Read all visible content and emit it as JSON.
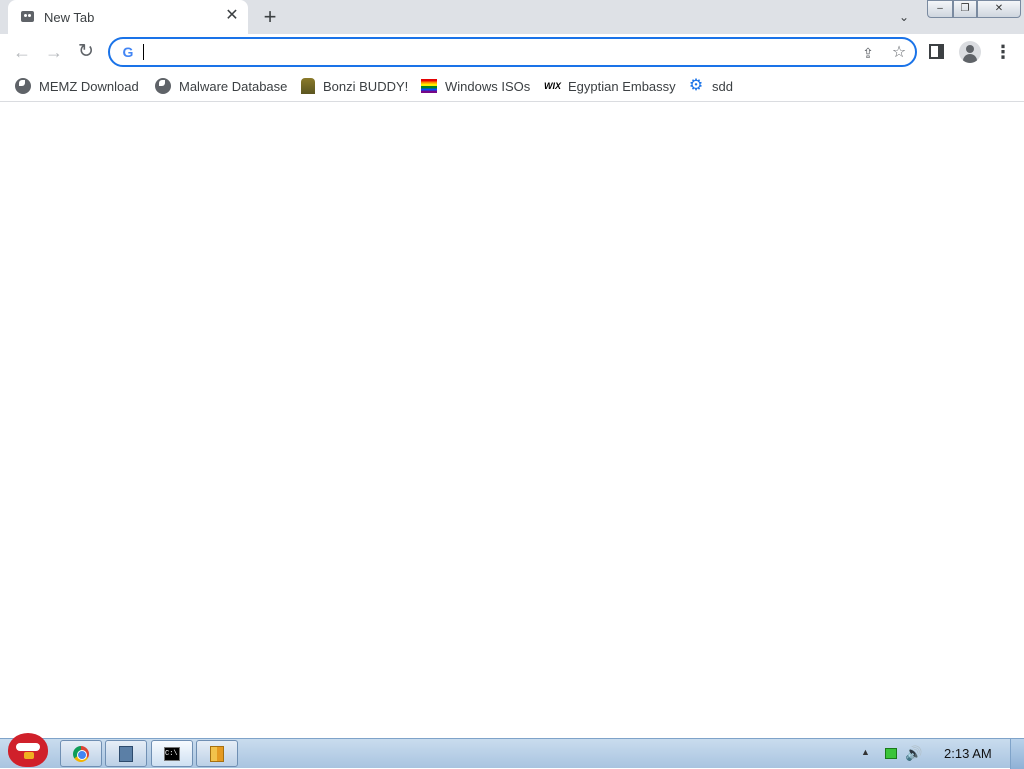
{
  "window": {
    "tab_title": "New Tab",
    "tab_close": "✕",
    "new_tab": "+",
    "tab_search": "⌄",
    "controls": {
      "minimize": "–",
      "maximize": "❐",
      "close": "✕"
    }
  },
  "toolbar": {
    "back": "←",
    "forward": "→",
    "reload": "↻",
    "omnibox_value": "",
    "omnibox_icon": "G",
    "share": "⇪",
    "star": "☆",
    "menu": "⋮"
  },
  "bookmarks": [
    {
      "label": "MEMZ Download",
      "icon": "globe-icon"
    },
    {
      "label": "Malware Database",
      "icon": "globe-icon"
    },
    {
      "label": "Bonzi BUDDY!",
      "icon": "bonzi-icon"
    },
    {
      "label": "Windows ISOs",
      "icon": "rainbow-flag-icon"
    },
    {
      "label": "Egyptian Embassy",
      "icon": "wix-icon",
      "icon_text": "WIX"
    },
    {
      "label": "sdd",
      "icon": "gear-icon",
      "icon_text": "⚙"
    }
  ],
  "taskbar": {
    "apps": [
      {
        "name": "chrome"
      },
      {
        "name": "generic-app"
      },
      {
        "name": "command-prompt",
        "icon_text": "C:\\"
      },
      {
        "name": "file-app"
      }
    ],
    "tray": {
      "arrow": "▲",
      "volume": "🔊",
      "clock": "2:13 AM"
    }
  },
  "colors": {
    "accent": "#1a73e8",
    "titlebar": "#dee1e6",
    "taskbar": "#bcd0e6"
  }
}
